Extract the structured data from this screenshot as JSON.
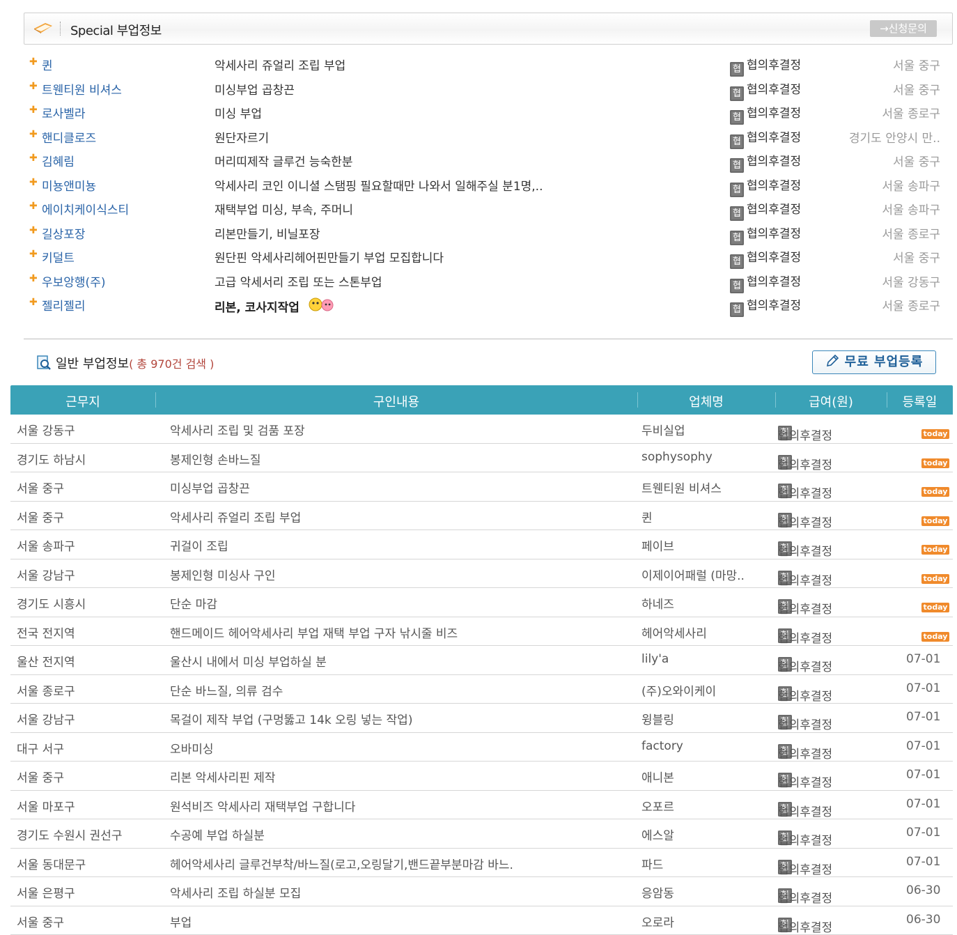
{
  "special": {
    "title": "Special 부업정보",
    "apply_button": "→신청문의",
    "rows": [
      {
        "company": "퀸",
        "content": "악세사리 쥬얼리 조립 부업",
        "pay": "협의후결정",
        "location": "서울 중구",
        "bold": false
      },
      {
        "company": "트웬티원 비셔스",
        "content": "미싱부업 곱창끈",
        "pay": "협의후결정",
        "location": "서울 중구",
        "bold": false
      },
      {
        "company": "로사벨라",
        "content": "미싱 부업",
        "pay": "협의후결정",
        "location": "서울 종로구",
        "bold": false
      },
      {
        "company": "핸디클로즈",
        "content": "원단자르기",
        "pay": "협의후결정",
        "location": "경기도 안양시 만..",
        "bold": false
      },
      {
        "company": "김혜림",
        "content": "머리띠제작 글루건 능숙한분",
        "pay": "협의후결정",
        "location": "서울 중구",
        "bold": false
      },
      {
        "company": "미뇽앤미뇽",
        "content": "악세사리 코인 이니셜 스탬핑 필요할때만 나와서 일해주실 분1명,..",
        "pay": "협의후결정",
        "location": "서울 송파구",
        "bold": false
      },
      {
        "company": "에이치케이식스티",
        "content": "재택부업 미싱, 부속, 주머니",
        "pay": "협의후결정",
        "location": "서울 송파구",
        "bold": false
      },
      {
        "company": "길상포장",
        "content": "리본만들기, 비닐포장",
        "pay": "협의후결정",
        "location": "서울 종로구",
        "bold": false
      },
      {
        "company": "키덜트",
        "content": "원단핀 악세사리헤어핀만들기 부업 모집합니다",
        "pay": "협의후결정",
        "location": "서울 중구",
        "bold": false
      },
      {
        "company": "우보앙행(주)",
        "content": "고급 악세서리 조립 또는 스톤부업",
        "pay": "협의후결정",
        "location": "서울 강동구",
        "bold": false
      },
      {
        "company": "젤리젤리",
        "content": "리본, 코사지작업",
        "pay": "협의후결정",
        "location": "서울 종로구",
        "bold": true
      }
    ]
  },
  "general": {
    "title": "일반 부업정보",
    "count_text": "( 총 970건 검색 )",
    "register_button": "무료 부업등록",
    "headers": [
      "근무지",
      "구인내용",
      "업체명",
      "급여(원)",
      "등록일"
    ],
    "pay_badge": "협",
    "today_label": "today",
    "rows": [
      {
        "location": "서울 강동구",
        "content": "악세사리 조립 및 검품 포장",
        "company": "두비실업",
        "pay": "협의후결정",
        "date": "today"
      },
      {
        "location": "경기도 하남시",
        "content": "봉제인형 손바느질",
        "company": "sophysophy",
        "pay": "협의후결정",
        "date": "today"
      },
      {
        "location": "서울 중구",
        "content": "미싱부업 곱창끈",
        "company": "트웬티원 비셔스",
        "pay": "협의후결정",
        "date": "today"
      },
      {
        "location": "서울 중구",
        "content": "악세사리 쥬얼리 조립 부업",
        "company": "퀸",
        "pay": "협의후결정",
        "date": "today"
      },
      {
        "location": "서울 송파구",
        "content": "귀걸이 조립",
        "company": "페이브",
        "pay": "협의후결정",
        "date": "today"
      },
      {
        "location": "서울 강남구",
        "content": "봉제인형 미싱사 구인",
        "company": "이제이어패럴 (마망..",
        "pay": "협의후결정",
        "date": "today"
      },
      {
        "location": "경기도 시흥시",
        "content": "단순 마감",
        "company": "하네즈",
        "pay": "협의후결정",
        "date": "today"
      },
      {
        "location": "전국 전지역",
        "content": "핸드메이드 헤어악세사리 부업 재택 부업 구자 낚시줄 비즈",
        "company": "헤어악세사리",
        "pay": "협의후결정",
        "date": "today"
      },
      {
        "location": "울산 전지역",
        "content": "울산시 내에서 미싱 부업하실 분",
        "company": "lily'a",
        "pay": "협의후결정",
        "date": "07-01"
      },
      {
        "location": "서울 종로구",
        "content": "단순 바느질, 의류 검수",
        "company": "(주)오와이케이",
        "pay": "협의후결정",
        "date": "07-01"
      },
      {
        "location": "서울 강남구",
        "content": "목걸이 제작 부업 (구멍뚫고 14k 오링 넣는 작업)",
        "company": "윙블링",
        "pay": "협의후결정",
        "date": "07-01"
      },
      {
        "location": "대구 서구",
        "content": "오바미싱",
        "company": "factory",
        "pay": "협의후결정",
        "date": "07-01"
      },
      {
        "location": "서울 중구",
        "content": "리본 악세사리핀 제작",
        "company": "애니본",
        "pay": "협의후결정",
        "date": "07-01"
      },
      {
        "location": "서울 마포구",
        "content": "원석비즈 악세사리 재택부업 구합니다",
        "company": "오포르",
        "pay": "협의후결정",
        "date": "07-01"
      },
      {
        "location": "경기도 수원시 권선구",
        "content": "수공예 부업 하실분",
        "company": "에스알",
        "pay": "협의후결정",
        "date": "07-01"
      },
      {
        "location": "서울 동대문구",
        "content": "헤어악세사리 글루건부착/바느질(로고,오링달기,밴드끝부분마감 바느.",
        "company": "파드",
        "pay": "협의후결정",
        "date": "07-01"
      },
      {
        "location": "서울 은평구",
        "content": "악세사리 조립 하실분 모집",
        "company": "응암동",
        "pay": "협의후결정",
        "date": "06-30"
      },
      {
        "location": "서울 중구",
        "content": "부업",
        "company": "오로라",
        "pay": "협의후결정",
        "date": "06-30"
      }
    ]
  },
  "colors": {
    "header_bg": "#3aa2b7",
    "company_link": "#2a64a8",
    "today_badge": "#f08a2b",
    "count_text": "#b2453b"
  },
  "icons": {
    "special": "folder-tag-icon",
    "general": "magnifier-document-icon",
    "register": "pencil-icon",
    "bullet": "plus-bullet-icon"
  }
}
